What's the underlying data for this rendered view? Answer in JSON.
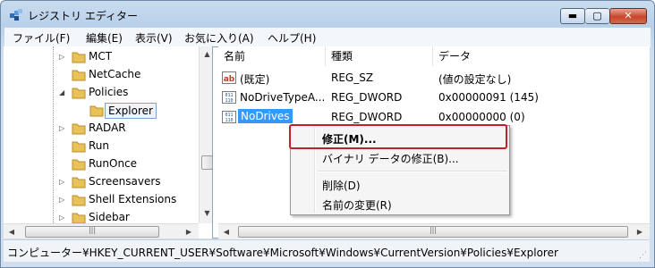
{
  "window": {
    "title": "レジストリ エディター",
    "controls": {
      "minimize": "▬",
      "maximize": "▢",
      "close": "✕"
    }
  },
  "menu": [
    "ファイル(F)",
    "編集(E)",
    "表示(V)",
    "お気に入り(A)",
    "ヘルプ(H)"
  ],
  "tree": {
    "items": [
      {
        "label": "MCT",
        "expander": "collapsed",
        "indent": 1
      },
      {
        "label": "NetCache",
        "expander": "none",
        "indent": 1
      },
      {
        "label": "Policies",
        "expander": "expanded",
        "indent": 1
      },
      {
        "label": "Explorer",
        "expander": "none",
        "indent": 2,
        "selected": true
      },
      {
        "label": "RADAR",
        "expander": "collapsed",
        "indent": 1
      },
      {
        "label": "Run",
        "expander": "none",
        "indent": 1
      },
      {
        "label": "RunOnce",
        "expander": "none",
        "indent": 1
      },
      {
        "label": "Screensavers",
        "expander": "collapsed",
        "indent": 1
      },
      {
        "label": "Shell Extensions",
        "expander": "collapsed",
        "indent": 1
      },
      {
        "label": "Sidebar",
        "expander": "collapsed",
        "indent": 1
      }
    ],
    "scroll_up": "▲",
    "scroll_down": "▼",
    "scroll_left": "◀",
    "scroll_right": "▶",
    "thumb_grip": "|||"
  },
  "list": {
    "columns": [
      "名前",
      "種類",
      "データ"
    ],
    "rows": [
      {
        "name": "(既定)",
        "type": "REG_SZ",
        "data": "(値の設定なし)",
        "icon": "string-value-icon",
        "icon_text": "ab"
      },
      {
        "name": "NoDriveTypeA...",
        "type": "REG_DWORD",
        "data": "0x00000091 (145)",
        "icon": "binary-value-icon",
        "icon_text": "011\n110"
      },
      {
        "name": "NoDrives",
        "type": "REG_DWORD",
        "data": "0x00000000 (0)",
        "icon": "binary-value-icon",
        "icon_text": "011\n110",
        "selected": true
      }
    ],
    "scroll_left": "◀",
    "scroll_right": "▶",
    "thumb_grip": "|||"
  },
  "context_menu": {
    "items": [
      "修正(M)...",
      "バイナリ データの修正(B)...",
      "削除(D)",
      "名前の変更(R)"
    ]
  },
  "status": {
    "path": "コンピューター¥HKEY_CURRENT_USER¥Software¥Microsoft¥Windows¥CurrentVersion¥Policies¥Explorer"
  },
  "colors": {
    "selection": "#3399ff",
    "tree_selection_border": "#7da2ce",
    "highlight_outline": "#c0202a",
    "folder": "#e8c15a"
  }
}
